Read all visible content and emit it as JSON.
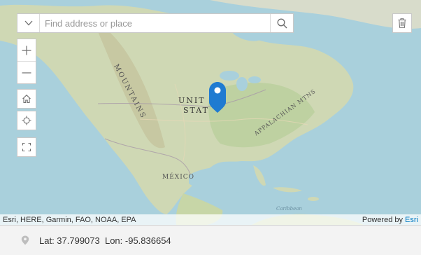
{
  "search": {
    "placeholder": "Find address or place"
  },
  "icons": {
    "dropdown": "triangle-down-icon",
    "search": "magnifier-icon",
    "trash": "trash-icon",
    "zoom_in": "plus-icon",
    "zoom_out": "minus-icon",
    "home": "home-icon",
    "locate": "crosshair-icon",
    "fullscreen": "expand-icon",
    "marker": "map-pin-icon"
  },
  "map": {
    "labels": {
      "mountains": "MOUNTAINS",
      "united_states_line1": "UNIT",
      "united_states_line2": "STAT",
      "appalachian": "APPALACHIAN MTNS",
      "mexico": "MÉXICO",
      "caribbean": "Caribbean"
    },
    "marker_color": "#1f7bd1"
  },
  "attribution": {
    "sources": "Esri, HERE, Garmin, FAO, NOAA, EPA",
    "powered_prefix": "Powered by ",
    "powered_brand": "Esri"
  },
  "status": {
    "location_text": "Lat: 37.799073  Lon: -95.836654"
  }
}
